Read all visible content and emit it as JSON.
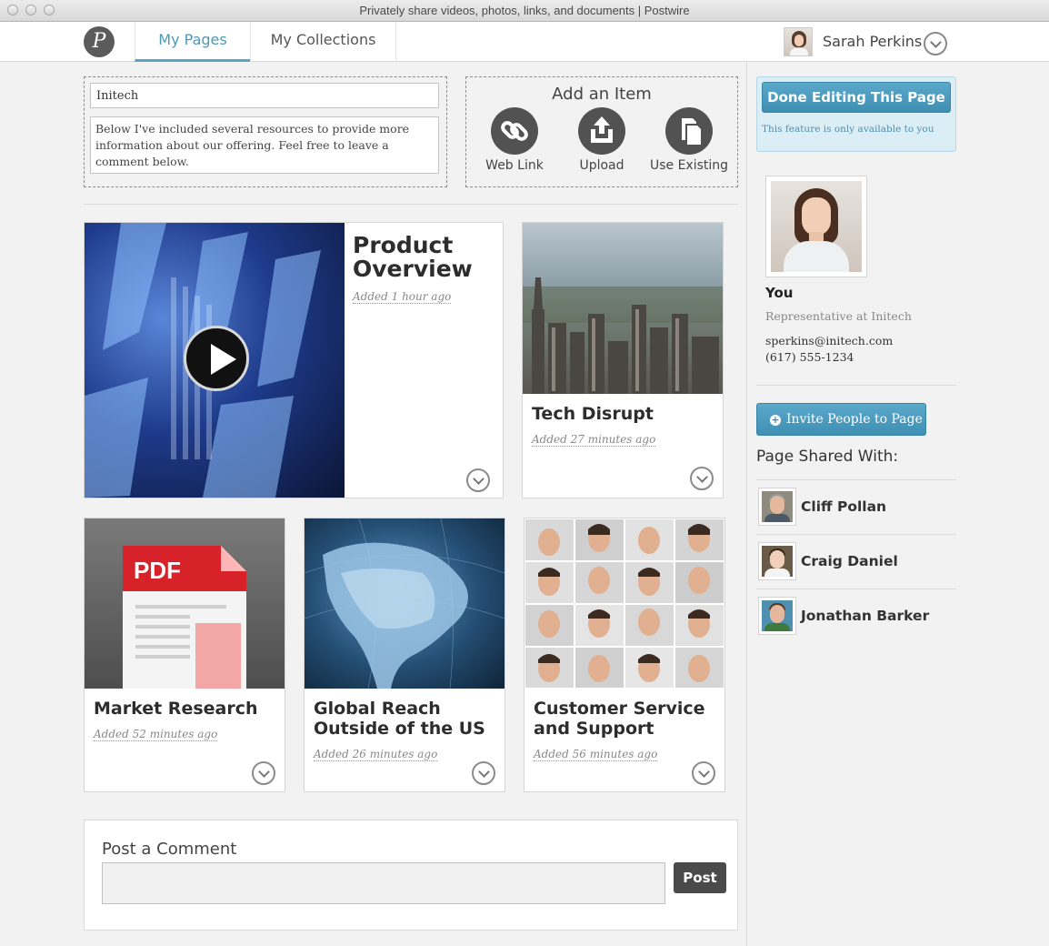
{
  "window": {
    "title": "Privately share videos, photos, links, and documents | Postwire"
  },
  "nav": {
    "logo_letter": "P",
    "tabs": [
      {
        "label": "My Pages"
      },
      {
        "label": "My Collections"
      }
    ],
    "active_tab": "My Pages",
    "user_name": "Sarah Perkins"
  },
  "editor": {
    "title_value": "Initech",
    "description_value": "Below I've included several resources to provide more information about our offering. Feel free to leave a comment below.",
    "add_item": {
      "title": "Add an Item",
      "buttons": [
        {
          "label": "Web Link",
          "icon": "link-icon"
        },
        {
          "label": "Upload",
          "icon": "upload-icon"
        },
        {
          "label": "Use Existing",
          "icon": "copy-icon"
        }
      ]
    }
  },
  "items": [
    {
      "title": "Product Overview",
      "added": "Added 1 hour ago",
      "type": "video"
    },
    {
      "title": "Tech Disrupt",
      "added": "Added 27 minutes ago",
      "type": "image"
    },
    {
      "title": "Market Research",
      "added": "Added 52 minutes ago",
      "type": "pdf",
      "badge": "PDF"
    },
    {
      "title": "Global Reach Outside of the US",
      "added": "Added 26 minutes ago",
      "type": "image"
    },
    {
      "title": "Customer Service and Support",
      "added": "Added 56 minutes ago",
      "type": "image"
    }
  ],
  "comment": {
    "label": "Post a Comment",
    "value": "",
    "post_label": "Post"
  },
  "sidebar": {
    "done_label": "Done Editing This Page",
    "done_note": "This feature is only available to you",
    "profile": {
      "name": "You",
      "role": "Representative at Initech",
      "email": "sperkins@initech.com",
      "phone": "(617) 555-1234"
    },
    "invite_label": "Invite People to Page",
    "shared_title": "Page Shared With:",
    "shared_with": [
      {
        "name": "Cliff Pollan"
      },
      {
        "name": "Craig Daniel"
      },
      {
        "name": "Jonathan Barker"
      }
    ]
  },
  "colors": {
    "accent": "#4a9ab8",
    "button_blue": "#4a9dc1",
    "dark_button": "#4a4a4a"
  }
}
